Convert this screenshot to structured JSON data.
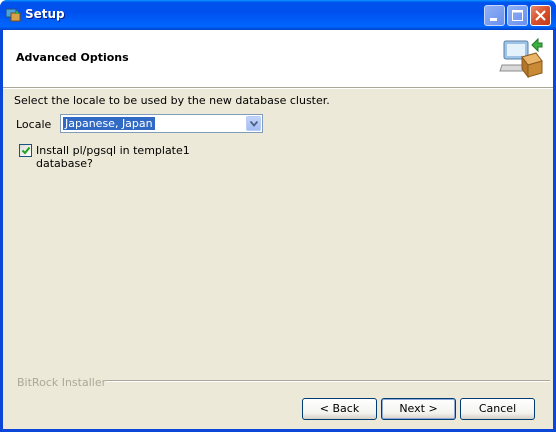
{
  "window": {
    "title": "Setup",
    "icon": "installer-app-icon",
    "controls": [
      "minimize-icon",
      "maximize-icon",
      "close-icon"
    ]
  },
  "header": {
    "title": "Advanced Options",
    "icon": "computer-install-icon"
  },
  "body": {
    "prompt": "Select the locale to be used by the new database cluster.",
    "locale_label": "Locale",
    "locale_value": "Japanese, Japan",
    "checkbox_label": "Install pl/pgsql in template1 database?",
    "checkbox_checked": true
  },
  "footer": {
    "brand": "BitRock Installer",
    "back_label": "< Back",
    "next_label": "Next >",
    "cancel_label": "Cancel"
  },
  "colors": {
    "titlebar": "#0050ee",
    "dialog_bg": "#ece9d8",
    "selection": "#316ac5"
  }
}
